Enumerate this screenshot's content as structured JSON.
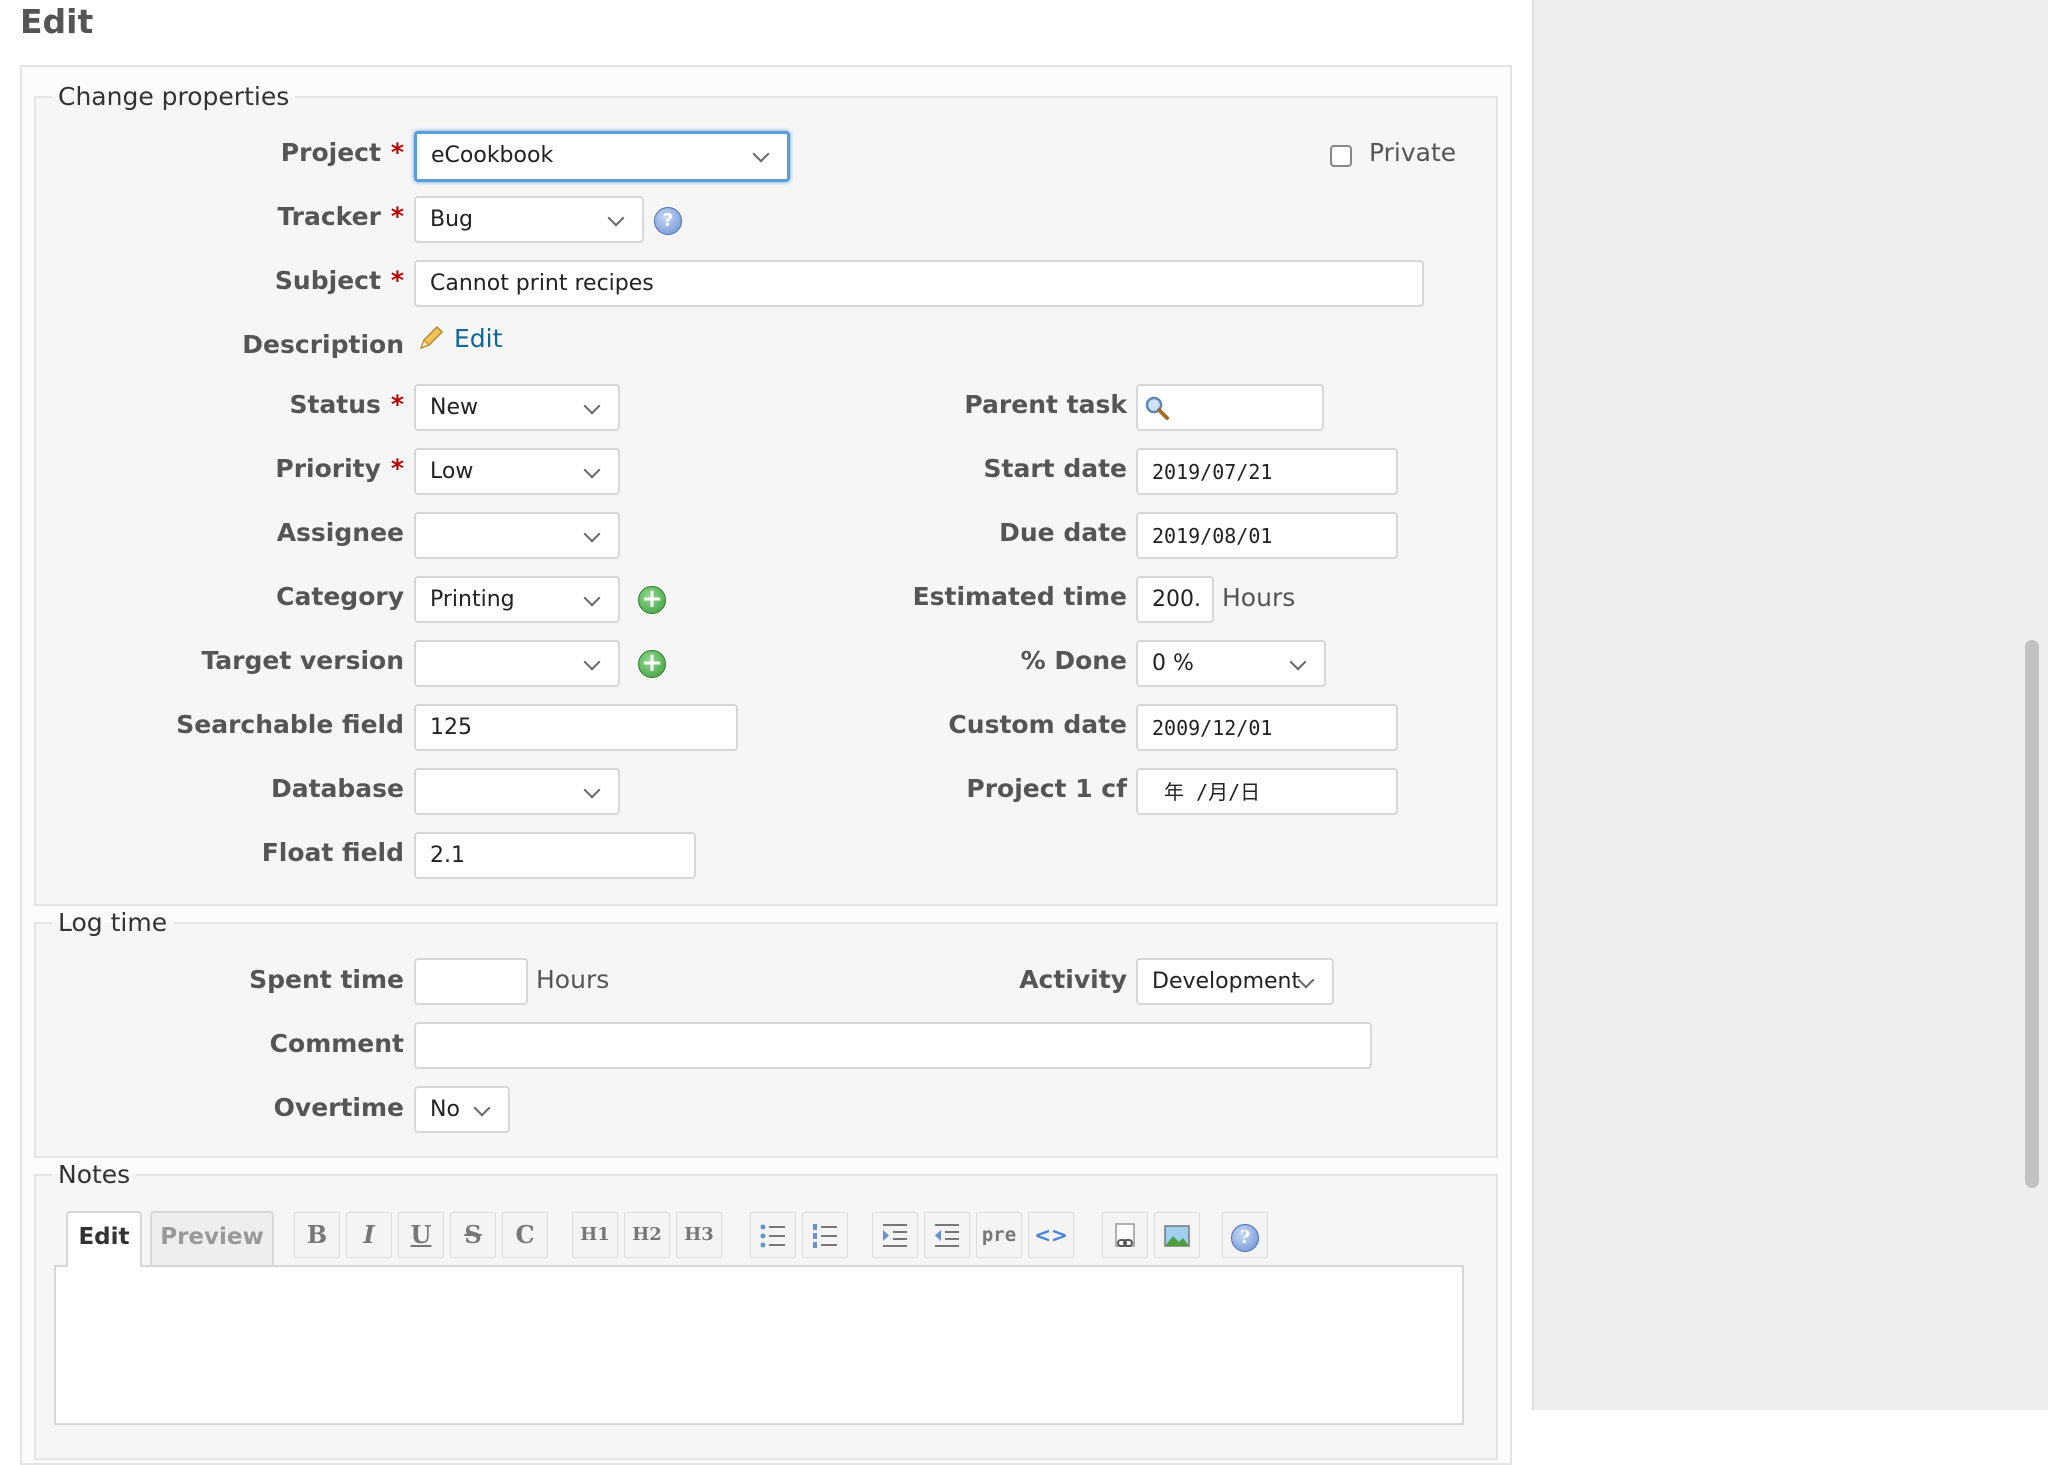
{
  "page": {
    "title": "Edit"
  },
  "change_properties": {
    "legend": "Change properties",
    "project": {
      "label": "Project",
      "value": "eCookbook"
    },
    "private": {
      "label": "Private",
      "checked": false
    },
    "tracker": {
      "label": "Tracker",
      "value": "Bug"
    },
    "subject": {
      "label": "Subject",
      "value": "Cannot print recipes"
    },
    "description": {
      "label": "Description",
      "edit_link": "Edit"
    },
    "status": {
      "label": "Status",
      "value": "New"
    },
    "priority": {
      "label": "Priority",
      "value": "Low"
    },
    "assignee": {
      "label": "Assignee",
      "value": ""
    },
    "category": {
      "label": "Category",
      "value": "Printing"
    },
    "target_version": {
      "label": "Target version",
      "value": ""
    },
    "searchable_field": {
      "label": "Searchable field",
      "value": "125"
    },
    "database": {
      "label": "Database",
      "value": ""
    },
    "float_field": {
      "label": "Float field",
      "value": "2.1"
    },
    "parent_task": {
      "label": "Parent task",
      "value": ""
    },
    "start_date": {
      "label": "Start date",
      "value": "2019/07/21"
    },
    "due_date": {
      "label": "Due date",
      "value": "2019/08/01"
    },
    "estimated_time": {
      "label": "Estimated time",
      "value": "200.",
      "unit": "Hours"
    },
    "done_ratio": {
      "label": "% Done",
      "value": "0 %"
    },
    "custom_date": {
      "label": "Custom date",
      "value": "2009/12/01"
    },
    "project_cf": {
      "label": "Project 1 cf",
      "placeholder": "年 /月/日"
    }
  },
  "log_time": {
    "legend": "Log time",
    "spent_time": {
      "label": "Spent time",
      "value": "",
      "unit": "Hours"
    },
    "activity": {
      "label": "Activity",
      "value": "Development"
    },
    "comment": {
      "label": "Comment",
      "value": ""
    },
    "overtime": {
      "label": "Overtime",
      "value": "No"
    }
  },
  "notes": {
    "legend": "Notes",
    "tab_edit": "Edit",
    "tab_preview": "Preview",
    "toolbar": {
      "bold": "B",
      "italic": "I",
      "underline": "U",
      "strike": "S",
      "code": "C",
      "h1": "H1",
      "h2": "H2",
      "h3": "H3",
      "pre": "pre",
      "inline_code": "<>"
    },
    "body": ""
  },
  "required_marker": "*",
  "colors": {
    "required": "#bb0000",
    "link": "#169",
    "focus": "#5b9dd9"
  }
}
